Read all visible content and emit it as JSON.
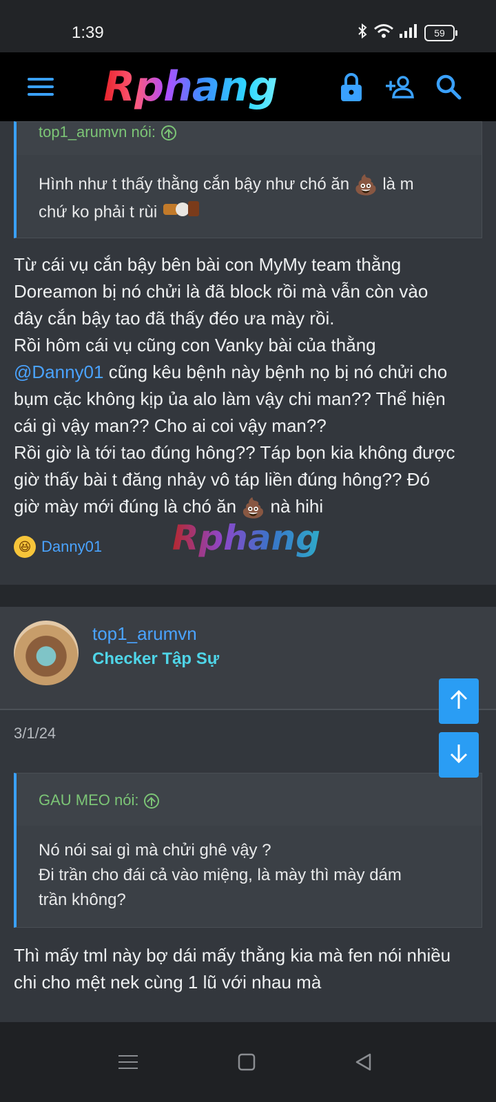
{
  "status": {
    "time": "1:39",
    "battery": "59"
  },
  "nav": {
    "logo": "Rphang"
  },
  "post1": {
    "quote_author": "top1_arumvn nói:",
    "quote_line1": "Hình như t thấy thằng cắn bậy như chó ăn",
    "quote_line1_tail": "là m",
    "quote_line2": "chứ ko phải t rùi",
    "body_p1": "Từ cái vụ cắn bậy bên bài con MyMy team thằng\nDoreamon bị nó chửi là đã block rồi mà vẫn còn vào\nđây cắn bậy tao đã thấy đéo ưa mày rồi.\nRồi hôm cái vụ cũng con Vanky bài của thằng",
    "mention": "@Danny01",
    "body_p2": " cũng kêu bệnh này bệnh nọ bị nó chửi cho\nbụm cặc không kịp ủa alo làm vậy chi man?? Thể hiện\ncái gì vậy man?? Cho ai coi vậy man??\nRồi giờ là tới tao đúng hông?? Táp bọn kia không được\ngiờ thấy bài t đăng nhảy vô táp liền đúng hông?? Đó\ngiờ mày mới đúng là chó ăn",
    "body_tail": "nà hihi",
    "reaction_user": "Danny01",
    "watermark": "Rphang"
  },
  "post2": {
    "username": "top1_arumvn",
    "user_title": "Checker Tập Sự",
    "date": "3/1/24",
    "quote_author": "GAU MEO nói:",
    "quote_text": "Nó nói sai gì mà chửi ghê vậy ?\nĐi trần cho đái cả vào miệng, là mày thì mày dám\ntrần không?",
    "body": "Thì mấy tml này bợ dái mấy thằng kia mà fen nói nhiều\nchi cho mệt nek cùng 1 lũ với nhau mà"
  },
  "icons": {
    "menu": "hamburger-icon",
    "lock": "lock-icon",
    "add_user": "add-user-icon",
    "search": "search-icon",
    "scroll_up": "arrow-up-icon",
    "scroll_down": "arrow-down-icon",
    "nav_menu": "menu-icon",
    "nav_home": "square-home-icon",
    "nav_back": "triangle-back-icon"
  }
}
